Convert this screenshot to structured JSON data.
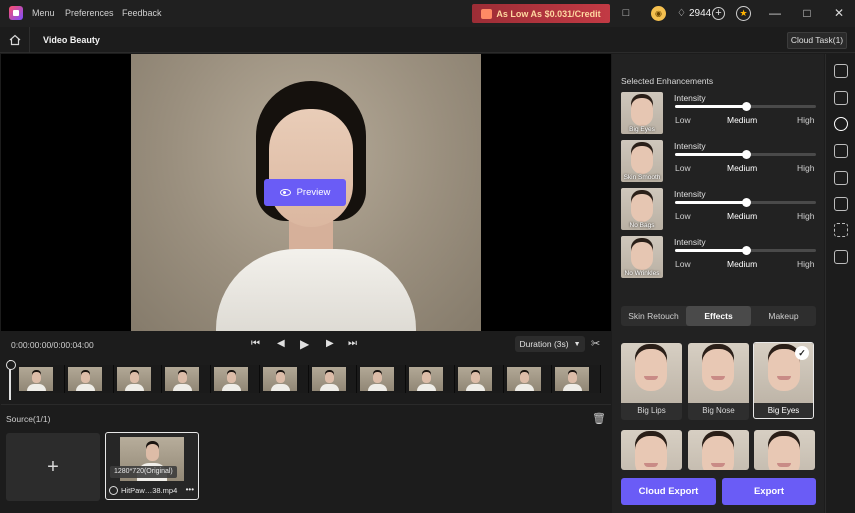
{
  "titlebar": {
    "menu_items": [
      "Menu",
      "Preferences",
      "Feedback"
    ],
    "promo": "As Low As $0.031/Credit",
    "credits": "2944"
  },
  "navbar": {
    "title": "Video Beauty",
    "cloud_task": "Cloud Task(1)"
  },
  "preview": {
    "button_label": "Preview"
  },
  "playback": {
    "timecode": "0:00:00:00/0:00:04:00",
    "duration_label": "Duration (3s)"
  },
  "timeline": {
    "frame_count": 12
  },
  "source": {
    "label": "Source(1/1)",
    "clip": {
      "resolution": "1280*720(Original)",
      "filename": "HitPaw…38.mp4"
    }
  },
  "enhancements": {
    "title": "Selected Enhancements",
    "items": [
      {
        "name": "Big Eyes",
        "intensity_label": "Intensity",
        "level": 0.5
      },
      {
        "name": "Skin Smooth",
        "intensity_label": "Intensity",
        "level": 0.5
      },
      {
        "name": "No Bags",
        "intensity_label": "Intensity",
        "level": 0.5
      },
      {
        "name": "No Wrinkles",
        "intensity_label": "Intensity",
        "level": 0.5
      }
    ],
    "levels": [
      "Low",
      "Medium",
      "High"
    ]
  },
  "tabs": [
    "Skin Retouch",
    "Effects",
    "Makeup"
  ],
  "active_tab": "Effects",
  "effects": [
    {
      "label": "Big Lips",
      "selected": false
    },
    {
      "label": "Big Nose",
      "selected": false
    },
    {
      "label": "Big Eyes",
      "selected": true
    }
  ],
  "actions": {
    "cloud_export": "Cloud Export",
    "export": "Export"
  },
  "colors": {
    "accent": "#6a5cf6",
    "promo": "#c23a44"
  }
}
